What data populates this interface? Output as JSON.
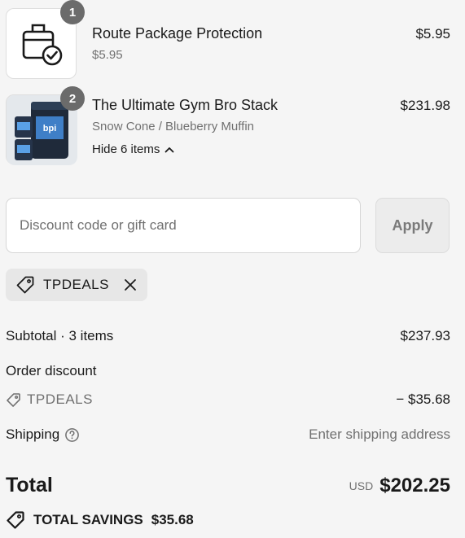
{
  "items": [
    {
      "name": "Route Package Protection",
      "variant": "$5.95",
      "price": "$5.95",
      "quantity": "1",
      "icon": "package-check-icon"
    },
    {
      "name": "The Ultimate Gym Bro Stack",
      "variant": "Snow Cone / Blueberry Muffin",
      "price": "$231.98",
      "quantity": "2",
      "toggle_label": "Hide 6 items",
      "image_text": "bpi"
    }
  ],
  "discount": {
    "placeholder": "Discount code or gift card",
    "apply_label": "Apply",
    "applied_code": "TPDEALS"
  },
  "summary": {
    "subtotal_label": "Subtotal · 3 items",
    "subtotal_value": "$237.93",
    "order_discount_label": "Order discount",
    "discount_code": "TPDEALS",
    "discount_value": "− $35.68",
    "shipping_label": "Shipping",
    "shipping_value": "Enter shipping address",
    "total_label": "Total",
    "currency": "USD",
    "total_value": "$202.25",
    "savings_label": "TOTAL SAVINGS",
    "savings_value": "$35.68"
  },
  "colors": {
    "background": "#f5f5f5",
    "badge": "#6b6b6b",
    "muted_text": "#707070"
  }
}
